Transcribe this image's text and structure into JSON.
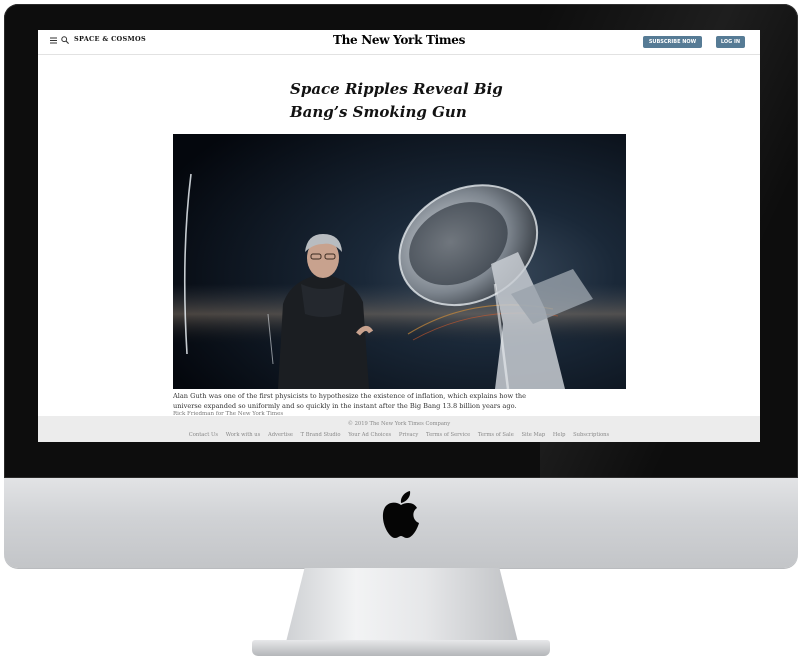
{
  "header": {
    "section": "SPACE & COSMOS",
    "masthead": "The New York Times",
    "subscribe_label": "SUBSCRIBE NOW",
    "login_label": "LOG IN",
    "icons": [
      "menu-icon",
      "search-icon"
    ]
  },
  "article": {
    "headline_line1": "Space Ripples Reveal Big",
    "headline_line2": "Bang’s Smoking Gun",
    "caption": "Alan Guth was one of the first physicists to hypothesize the existence of inflation, which explains how the universe expanded so uniformly and so quickly in the instant after the Big Bang 13.8 billion years ago.",
    "credit": "Rick Friedman for The New York Times"
  },
  "footer": {
    "copyright": "© 2019 The New York Times Company",
    "links": [
      "Contact Us",
      "Work with us",
      "Advertise",
      "T Brand Studio",
      "Your Ad Choices",
      "Privacy",
      "Terms of Service",
      "Terms of Sale",
      "Site Map",
      "Help",
      "Subscriptions"
    ]
  },
  "colors": {
    "button_bg": "#567b95",
    "footer_bg": "#ececec",
    "bezel": "#0d0d0d",
    "chin": "#d0d2d5"
  }
}
